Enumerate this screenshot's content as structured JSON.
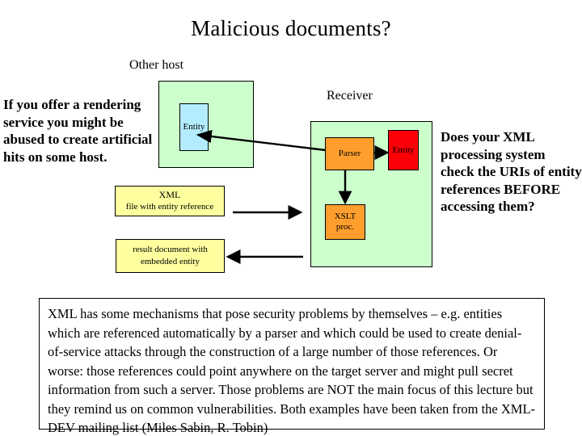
{
  "slide": {
    "title": "Malicious documents?"
  },
  "captions": {
    "other_host": "Other host",
    "receiver": "Receiver"
  },
  "text_blocks": {
    "left": "If you offer a rendering service you might be abused to create artificial hits on some host.",
    "right": "Does your XML processing system check the URIs of entity references BEFORE accessing them?"
  },
  "nodes": {
    "entity_remote": {
      "label": "Entity",
      "color": "#b3ecff"
    },
    "parser": {
      "label": "Parser",
      "color": "#ff9e2c"
    },
    "entity_local": {
      "label": "Entity",
      "color": "#fb0007"
    },
    "xslt": {
      "line1": "XSLT",
      "line2": "proc.",
      "color": "#ff9e2c"
    }
  },
  "documents": {
    "xml_file": {
      "line1": "XML",
      "line2": "file with entity reference",
      "color": "#ffffa0"
    },
    "result_doc": {
      "line1": "result document with",
      "line2": "embedded entity",
      "color": "#ffffa0"
    }
  },
  "panels": {
    "other_host": {
      "color": "#ccffcc"
    },
    "receiver": {
      "color": "#ccffcc"
    }
  },
  "bottom_note": {
    "text": "XML has some mechanisms that pose security problems by themselves – e.g. entities which are referenced automatically by a parser and which could be used to create denial-of-service attacks through the construction of a large number of those references. Or worse: those references could point anywhere on the target server and might pull secret information from such a server. Those problems are NOT the main focus of this lecture but they remind us on common vulnerabilities. Both examples have been taken from the XML-DEV mailing list (Miles Sabin, R. Tobin)"
  },
  "arrows": {
    "parser_to_remote_entity": "diagonal-arrow-left",
    "parser_to_local_entity": "arrow-right",
    "parser_to_xslt": "arrow-down",
    "xml_file_to_receiver": "arrow-right",
    "receiver_to_result_doc": "arrow-left"
  }
}
